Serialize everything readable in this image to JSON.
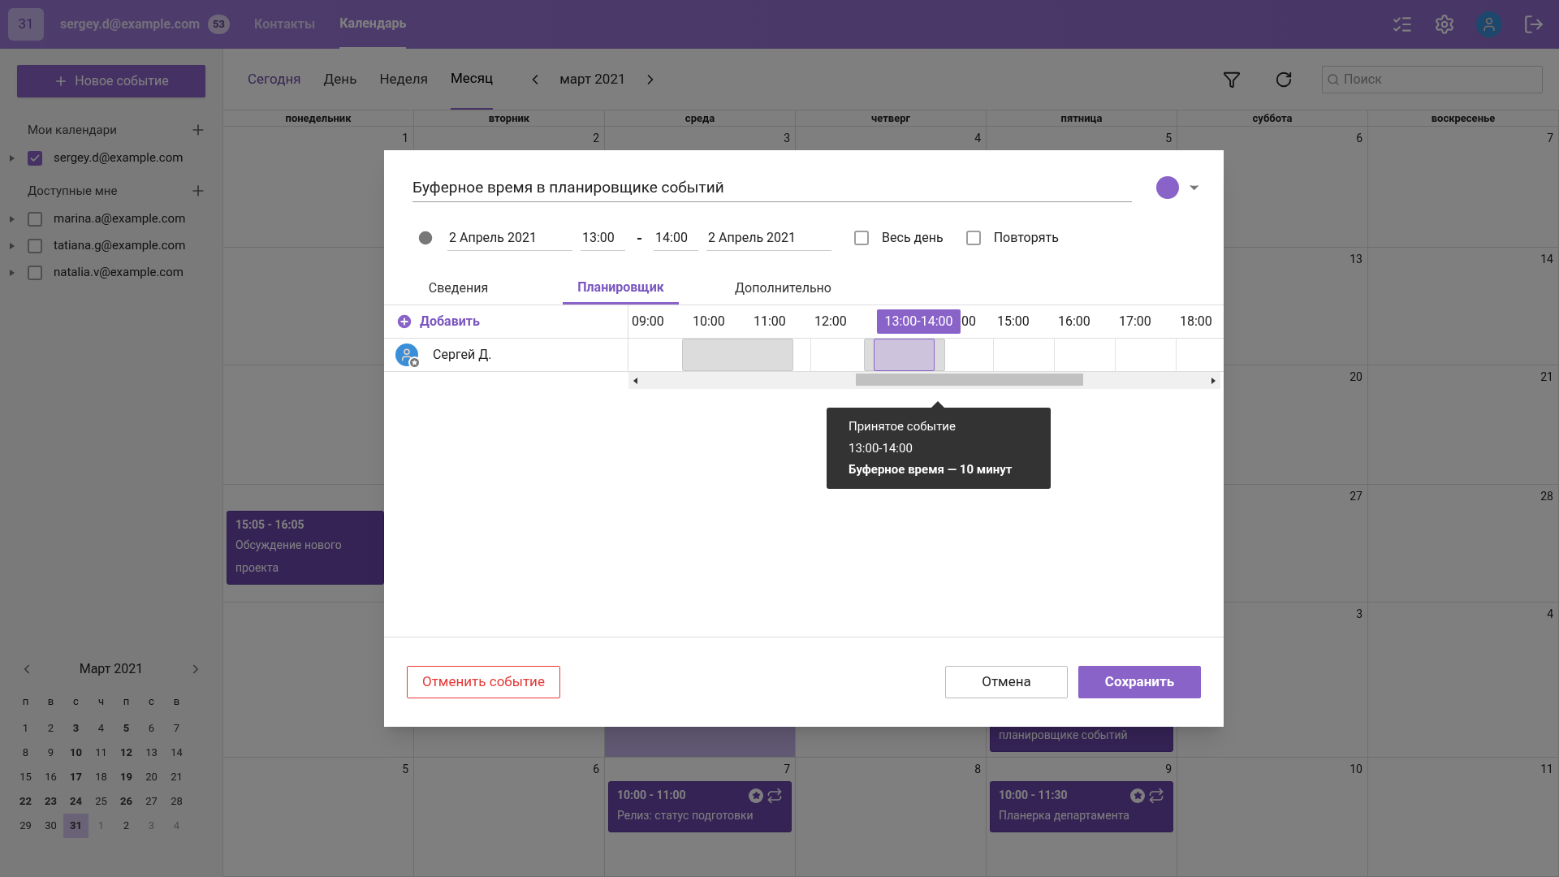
{
  "topbar": {
    "logo": "31",
    "account": "sergey.d@example.com",
    "unread": "53",
    "nav": [
      {
        "label": "Контакты",
        "selected": false
      },
      {
        "label": "Календарь",
        "selected": true
      }
    ]
  },
  "sidebar": {
    "new_event": "Новое событие",
    "my_header": "Мои календари",
    "my": [
      {
        "label": "sergey.d@example.com",
        "checked": true
      }
    ],
    "shared_header": "Доступные мне",
    "shared": [
      {
        "label": "marina.a@example.com",
        "checked": false
      },
      {
        "label": "tatiana.g@example.com",
        "checked": false
      },
      {
        "label": "natalia.v@example.com",
        "checked": false
      }
    ],
    "mini": {
      "title": "Март 2021",
      "weekdays": [
        "п",
        "в",
        "с",
        "ч",
        "п",
        "с",
        "в"
      ],
      "weeks": [
        [
          {
            "d": "1",
            "bold": false,
            "muted": false,
            "selected": false
          },
          {
            "d": "2",
            "bold": false,
            "muted": false,
            "selected": false
          },
          {
            "d": "3",
            "bold": true,
            "muted": false,
            "selected": false
          },
          {
            "d": "4",
            "bold": false,
            "muted": false,
            "selected": false
          },
          {
            "d": "5",
            "bold": true,
            "muted": false,
            "selected": false
          },
          {
            "d": "6",
            "bold": false,
            "muted": false,
            "selected": false
          },
          {
            "d": "7",
            "bold": false,
            "muted": false,
            "selected": false
          }
        ],
        [
          {
            "d": "8",
            "bold": false,
            "muted": false,
            "selected": false
          },
          {
            "d": "9",
            "bold": false,
            "muted": false,
            "selected": false
          },
          {
            "d": "10",
            "bold": true,
            "muted": false,
            "selected": false
          },
          {
            "d": "11",
            "bold": false,
            "muted": false,
            "selected": false
          },
          {
            "d": "12",
            "bold": true,
            "muted": false,
            "selected": false
          },
          {
            "d": "13",
            "bold": false,
            "muted": false,
            "selected": false
          },
          {
            "d": "14",
            "bold": false,
            "muted": false,
            "selected": false
          }
        ],
        [
          {
            "d": "15",
            "bold": false,
            "muted": false,
            "selected": false
          },
          {
            "d": "16",
            "bold": false,
            "muted": false,
            "selected": false
          },
          {
            "d": "17",
            "bold": true,
            "muted": false,
            "selected": false
          },
          {
            "d": "18",
            "bold": false,
            "muted": false,
            "selected": false
          },
          {
            "d": "19",
            "bold": true,
            "muted": false,
            "selected": false
          },
          {
            "d": "20",
            "bold": false,
            "muted": false,
            "selected": false
          },
          {
            "d": "21",
            "bold": false,
            "muted": false,
            "selected": false
          }
        ],
        [
          {
            "d": "22",
            "bold": true,
            "muted": false,
            "selected": false
          },
          {
            "d": "23",
            "bold": true,
            "muted": false,
            "selected": false
          },
          {
            "d": "24",
            "bold": true,
            "muted": false,
            "selected": false
          },
          {
            "d": "25",
            "bold": false,
            "muted": false,
            "selected": false
          },
          {
            "d": "26",
            "bold": true,
            "muted": false,
            "selected": false
          },
          {
            "d": "27",
            "bold": false,
            "muted": false,
            "selected": false
          },
          {
            "d": "28",
            "bold": false,
            "muted": false,
            "selected": false
          }
        ],
        [
          {
            "d": "29",
            "bold": false,
            "muted": false,
            "selected": false
          },
          {
            "d": "30",
            "bold": false,
            "muted": false,
            "selected": false
          },
          {
            "d": "31",
            "bold": true,
            "muted": false,
            "selected": true
          },
          {
            "d": "1",
            "bold": false,
            "muted": true,
            "selected": false
          },
          {
            "d": "2",
            "bold": false,
            "muted": false,
            "selected": false
          },
          {
            "d": "3",
            "bold": false,
            "muted": true,
            "selected": false
          },
          {
            "d": "4",
            "bold": false,
            "muted": true,
            "selected": false
          }
        ]
      ]
    }
  },
  "toolbar": {
    "today": "Сегодня",
    "views": [
      {
        "label": "День",
        "selected": false
      },
      {
        "label": "Неделя",
        "selected": false
      },
      {
        "label": "Месяц",
        "selected": true
      }
    ],
    "period": "март 2021",
    "search_placeholder": "Поиск"
  },
  "month": {
    "weekdays": [
      "понедельник",
      "вторник",
      "среда",
      "четверг",
      "пятница",
      "суббота",
      "воскресенье"
    ],
    "weeks": [
      {
        "mon": {
          "day": "1",
          "today": false
        },
        "tue": {
          "day": "2",
          "today": false
        },
        "wed": {
          "day": "3",
          "today": false
        },
        "thu": {
          "day": "4",
          "today": false
        },
        "fri": {
          "day": "5",
          "today": false
        },
        "sat": {
          "day": "6",
          "today": false
        },
        "sun": {
          "day": "7",
          "today": false
        }
      },
      {
        "mon": {
          "today": false
        },
        "sat": {
          "day": "13",
          "today": false
        },
        "sun": {
          "day": "14",
          "today": false
        }
      },
      {
        "mon": {
          "today": false
        },
        "sat": {
          "day": "20",
          "today": false
        },
        "sun": {
          "day": "21",
          "today": false
        }
      },
      {
        "mon": {
          "today": false,
          "events": [
            {
              "time": "15:05 - 16:05",
              "title": "Обсуждение нового проекта"
            }
          ]
        },
        "sat": {
          "day": "27",
          "today": false
        },
        "sun": {
          "day": "28",
          "today": false
        }
      },
      {
        "mon": {
          "today": false
        },
        "tue": {
          "today": false
        },
        "wed": {
          "today": true
        },
        "thu": {
          "today": false
        },
        "fri": {
          "today": false,
          "events": [
            {
              "title": "планировщике событий"
            }
          ]
        },
        "sat": {
          "day": "3",
          "today": false
        },
        "sun": {
          "day": "4",
          "today": false
        }
      },
      {
        "mon": {
          "day": "5",
          "today": false
        },
        "tue": {
          "day": "6",
          "today": false
        },
        "wed": {
          "day": "7",
          "today": false,
          "events": [
            {
              "time": "10:00 - 11:00",
              "title": "Релиз: статус подготовки",
              "important": true,
              "recurring": true
            }
          ]
        },
        "thu": {
          "day": "8",
          "today": false
        },
        "fri": {
          "day": "9",
          "today": false,
          "events": [
            {
              "time": "10:00 - 11:30",
              "title": "Планерка департамента",
              "important": true,
              "recurring": true
            }
          ]
        },
        "sat": {
          "day": "10",
          "today": false
        },
        "sun": {
          "day": "11",
          "today": false
        }
      }
    ]
  },
  "dialog": {
    "title": "Буферное время в планировщике событий",
    "color": "#8a63c9",
    "start_date": "2 Апрель 2021",
    "start_time": "13:00",
    "dash": "-",
    "end_time": "14:00",
    "end_date": "2 Апрель 2021",
    "options": [
      {
        "label": "Весь день",
        "checked": false
      },
      {
        "label": "Повторять",
        "checked": false
      }
    ],
    "tabs": [
      {
        "label": "Сведения",
        "selected": false
      },
      {
        "label": "Планировщик",
        "selected": true
      },
      {
        "label": "Дополнительно",
        "selected": false
      }
    ],
    "scheduler": {
      "add": "Добавить",
      "hours": [
        {
          "kind": "hour",
          "label": "09:00"
        },
        {
          "kind": "hour",
          "label": "10:00"
        },
        {
          "kind": "hour",
          "label": "11:00"
        },
        {
          "kind": "hour",
          "label": "12:00"
        },
        {
          "kind": "range",
          "label": "13:00-14:00",
          "tail": "00"
        },
        {
          "kind": "hour",
          "label": "15:00"
        },
        {
          "kind": "hour",
          "label": "16:00"
        },
        {
          "kind": "hour",
          "label": "17:00"
        },
        {
          "kind": "hour",
          "label": "18:00"
        }
      ],
      "attendees": [
        {
          "name": "Сергей Д."
        }
      ],
      "tooltip": [
        "Принятое событие",
        "13:00-14:00",
        "Буферное время — 10 минут"
      ]
    },
    "cancel_event": "Отменить событие",
    "cancel": "Отмена",
    "save": "Сохранить"
  }
}
